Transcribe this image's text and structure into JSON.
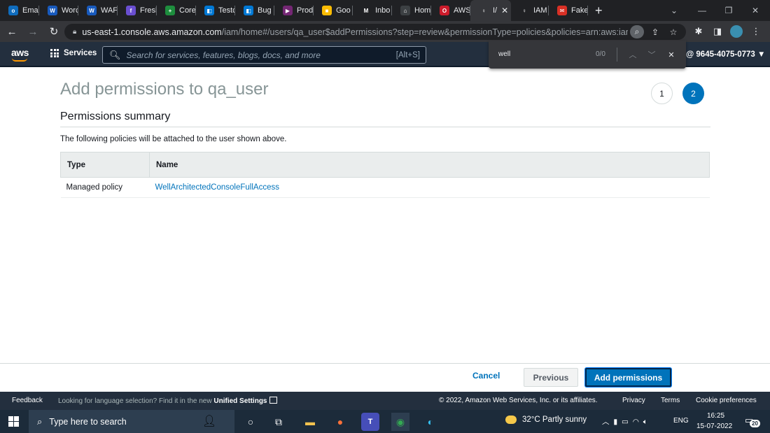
{
  "browser": {
    "tabs": [
      {
        "label": "Emai",
        "icon": "outlook-icon",
        "color": "#0f6cbd",
        "glyph": "o"
      },
      {
        "label": "Worc",
        "icon": "word-icon",
        "color": "#185abd",
        "glyph": "W"
      },
      {
        "label": "WAF",
        "icon": "word-icon",
        "color": "#185abd",
        "glyph": "W"
      },
      {
        "label": "Fresh",
        "icon": "freshdesk-icon",
        "color": "#6a4fd1",
        "glyph": "f"
      },
      {
        "label": "Core",
        "icon": "sheets-icon",
        "color": "#1e8e3e",
        "glyph": "+"
      },
      {
        "label": "Testc",
        "icon": "azure-devops-icon",
        "color": "#0078d4",
        "glyph": "◧"
      },
      {
        "label": "Bug ,",
        "icon": "azure-devops-icon",
        "color": "#0078d4",
        "glyph": "◧"
      },
      {
        "label": "Prod",
        "icon": "powerapps-icon",
        "color": "#742774",
        "glyph": "▶"
      },
      {
        "label": "Goo",
        "icon": "keep-icon",
        "color": "#fbbc04",
        "glyph": "■"
      },
      {
        "label": "Inbo",
        "icon": "gmail-icon",
        "color": "#202124",
        "glyph": "M"
      },
      {
        "label": "Hom",
        "icon": "home-icon",
        "color": "#3c4043",
        "glyph": "⌂"
      },
      {
        "label": "AWS",
        "icon": "opera-icon",
        "color": "#cc1b2b",
        "glyph": "O"
      },
      {
        "label": "I/",
        "icon": "key-icon",
        "color": "#35363a",
        "glyph": "♀",
        "active": true
      },
      {
        "label": "IAM",
        "icon": "key-icon",
        "color": "#202124",
        "glyph": "♀"
      },
      {
        "label": "Fake",
        "icon": "mail-icon",
        "color": "#d93025",
        "glyph": "✉"
      }
    ],
    "url_host": "us-east-1.console.aws.amazon.com",
    "url_path": "/iam/home#/users/qa_user$addPermissions?step=review&permissionType=policies&policies=arn:aws:iam::a..."
  },
  "aws_nav": {
    "logo": "aws",
    "services_label": "Services",
    "search_placeholder": "Search for services, features, blogs, docs, and more",
    "search_hint": "[Alt+S]",
    "account": "@ 9645-4075-0773 ▼"
  },
  "find_bar": {
    "query": "well",
    "count": "0/0"
  },
  "page": {
    "title": "Add permissions to qa_user",
    "steps": [
      "1",
      "2"
    ],
    "section_title": "Permissions summary",
    "description": "The following policies will be attached to the user shown above.",
    "table": {
      "headers": [
        "Type",
        "Name"
      ],
      "rows": [
        {
          "type": "Managed policy",
          "name": "WellArchitectedConsoleFullAccess"
        }
      ]
    }
  },
  "actions": {
    "cancel": "Cancel",
    "previous": "Previous",
    "add": "Add permissions"
  },
  "aws_footer": {
    "feedback": "Feedback",
    "message": "Looking for language selection? Find it in the new ",
    "message_link": "Unified Settings",
    "copyright": "© 2022, Amazon Web Services, Inc. or its affiliates.",
    "privacy": "Privacy",
    "terms": "Terms",
    "cookies": "Cookie preferences"
  },
  "taskbar": {
    "search_placeholder": "Type here to search",
    "weather": "32°C  Partly sunny",
    "language": "ENG",
    "time": "16:25",
    "date": "15-07-2022",
    "notifications": "20"
  }
}
